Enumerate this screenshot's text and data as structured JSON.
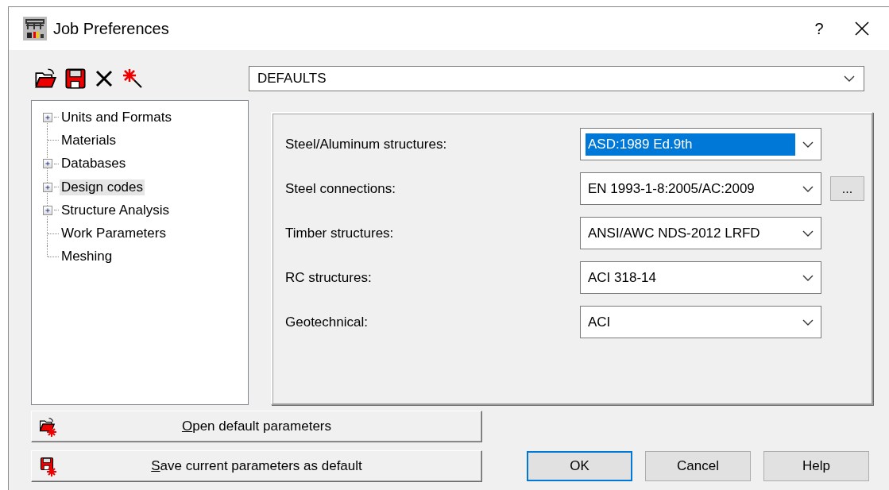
{
  "window": {
    "title": "Job Preferences",
    "help_glyph": "?"
  },
  "profile": {
    "value": "DEFAULTS"
  },
  "tree": [
    {
      "label": "Units and Formats",
      "kind": "folder",
      "selected": false
    },
    {
      "label": "Materials",
      "kind": "leaf",
      "selected": false
    },
    {
      "label": "Databases",
      "kind": "folder",
      "selected": false
    },
    {
      "label": "Design codes",
      "kind": "folder",
      "selected": true
    },
    {
      "label": "Structure Analysis",
      "kind": "folder",
      "selected": false
    },
    {
      "label": "Work Parameters",
      "kind": "leaf",
      "selected": false
    },
    {
      "label": "Meshing",
      "kind": "leaf",
      "selected": false
    }
  ],
  "codes": [
    {
      "label": "Steel/Aluminum structures:",
      "value": "ASD:1989 Ed.9th",
      "highlighted": true
    },
    {
      "label": "Steel connections:",
      "value": "EN 1993-1-8:2005/AC:2009",
      "highlighted": false,
      "more_button": "..."
    },
    {
      "label": "Timber structures:",
      "value": "ANSI/AWC NDS-2012 LRFD",
      "highlighted": false
    },
    {
      "label": "RC structures:",
      "value": "ACI 318-14",
      "highlighted": false
    },
    {
      "label": "Geotechnical:",
      "value": "ACI",
      "highlighted": false
    }
  ],
  "default_buttons": [
    {
      "label": "Open default parameters",
      "kind": "open",
      "mnemonic_underlined": true
    },
    {
      "label": "Save current parameters as default",
      "kind": "save",
      "mnemonic_underlined": true
    }
  ],
  "buttons": [
    {
      "label": "OK",
      "default": true
    },
    {
      "label": "Cancel",
      "default": false
    },
    {
      "label": "Help",
      "default": false
    }
  ]
}
